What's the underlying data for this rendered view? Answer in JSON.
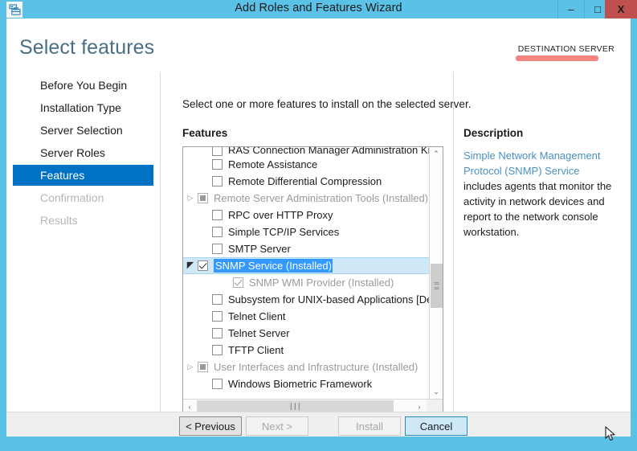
{
  "window": {
    "title": "Add Roles and Features Wizard",
    "icon": "wizard-server-icon",
    "minimize_label": "–",
    "maximize_label": "□",
    "close_label": "X",
    "frame_color": "#5bc2e7",
    "close_button_color": "#c0504d"
  },
  "header": {
    "page_title": "Select features",
    "destination_server_label": "DESTINATION SERVER",
    "destination_server_value_redacted": true,
    "redaction_color": "#f4847f",
    "title_color": "#4a6e85"
  },
  "sidebar": {
    "selected_color": "#0072c6",
    "items": [
      {
        "label": "Before You Begin",
        "state": "normal"
      },
      {
        "label": "Installation Type",
        "state": "normal"
      },
      {
        "label": "Server Selection",
        "state": "normal"
      },
      {
        "label": "Server Roles",
        "state": "normal"
      },
      {
        "label": "Features",
        "state": "selected"
      },
      {
        "label": "Confirmation",
        "state": "disabled"
      },
      {
        "label": "Results",
        "state": "disabled"
      }
    ]
  },
  "main": {
    "instruction": "Select one or more features to install on the selected server.",
    "features_label": "Features",
    "rows": [
      {
        "label": "RAS Connection Manager Administration Kit (CMA",
        "checkbox": "unchecked",
        "expander": "none",
        "indent": 1,
        "state": "normal",
        "clipped_top": true
      },
      {
        "label": "Remote Assistance",
        "checkbox": "unchecked",
        "expander": "none",
        "indent": 1,
        "state": "normal"
      },
      {
        "label": "Remote Differential Compression",
        "checkbox": "unchecked",
        "expander": "none",
        "indent": 1,
        "state": "normal"
      },
      {
        "label": "Remote Server Administration Tools (Installed)",
        "checkbox": "partial",
        "expander": "collapsed",
        "indent": 0,
        "state": "disabled"
      },
      {
        "label": "RPC over HTTP Proxy",
        "checkbox": "unchecked",
        "expander": "none",
        "indent": 1,
        "state": "normal"
      },
      {
        "label": "Simple TCP/IP Services",
        "checkbox": "unchecked",
        "expander": "none",
        "indent": 1,
        "state": "normal"
      },
      {
        "label": "SMTP Server",
        "checkbox": "unchecked",
        "expander": "none",
        "indent": 1,
        "state": "normal"
      },
      {
        "label": "SNMP Service (Installed)",
        "checkbox": "checked",
        "expander": "expanded",
        "indent": 0,
        "state": "selected"
      },
      {
        "label": "SNMP WMI Provider (Installed)",
        "checkbox": "checked-gray",
        "expander": "none",
        "indent": 2,
        "state": "disabled"
      },
      {
        "label": "Subsystem for UNIX-based Applications [Deprecat",
        "checkbox": "unchecked",
        "expander": "none",
        "indent": 1,
        "state": "normal"
      },
      {
        "label": "Telnet Client",
        "checkbox": "unchecked",
        "expander": "none",
        "indent": 1,
        "state": "normal"
      },
      {
        "label": "Telnet Server",
        "checkbox": "unchecked",
        "expander": "none",
        "indent": 1,
        "state": "normal"
      },
      {
        "label": "TFTP Client",
        "checkbox": "unchecked",
        "expander": "none",
        "indent": 1,
        "state": "normal"
      },
      {
        "label": "User Interfaces and Infrastructure (Installed)",
        "checkbox": "partial",
        "expander": "collapsed",
        "indent": 0,
        "state": "disabled"
      },
      {
        "label": "Windows Biometric Framework",
        "checkbox": "unchecked",
        "expander": "none",
        "indent": 1,
        "state": "normal"
      }
    ],
    "scrollbars": {
      "vertical_up_glyph": "⌃",
      "vertical_down_glyph": "⌄",
      "vertical_grip": "≡",
      "horizontal_left_glyph": "‹",
      "horizontal_right_glyph": "›",
      "horizontal_grip": "∣∣∣"
    }
  },
  "description": {
    "title": "Description",
    "highlight_text": "Simple Network Management Protocol (SNMP) Service",
    "rest_text": " includes agents that monitor the activity in network devices and report to the network console workstation.",
    "highlight_color": "#4a90bf"
  },
  "footer": {
    "previous_label": "< Previous",
    "next_label": "Next >",
    "install_label": "Install",
    "cancel_label": "Cancel"
  }
}
